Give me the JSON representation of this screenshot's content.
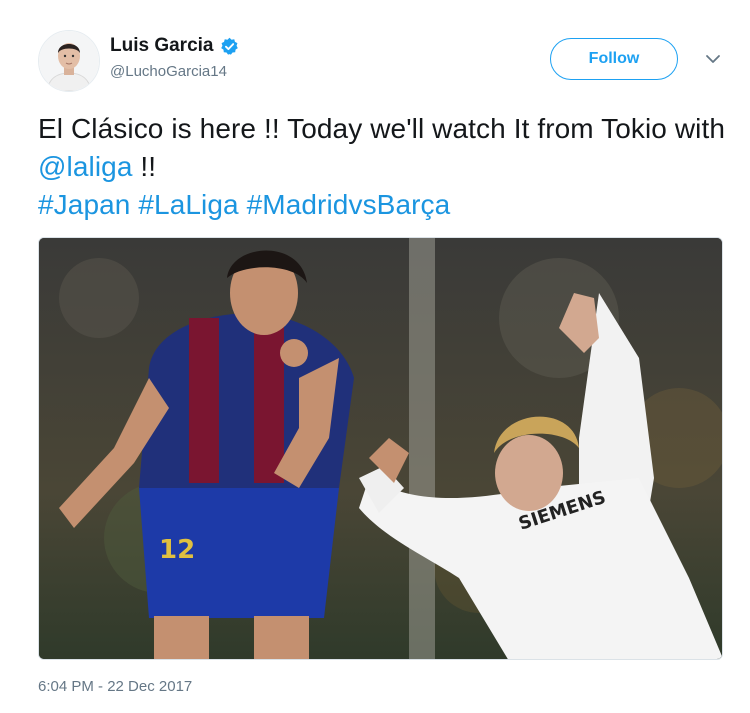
{
  "user": {
    "display_name": "Luis Garcia",
    "handle": "@LuchoGarcia14",
    "verified": true
  },
  "actions": {
    "follow_label": "Follow"
  },
  "tweet": {
    "text_part1": "El Clásico is here !! Today we'll watch It from Tokio with ",
    "mention": "@laliga",
    "text_part2": " !!",
    "hashtags": [
      "#Japan",
      "#LaLiga",
      "#MadridvsBarça"
    ]
  },
  "media": {
    "jersey_number": "12",
    "sponsor_text": "SIEMENS"
  },
  "timestamp": "6:04 PM - 22 Dec 2017",
  "colors": {
    "link": "#1b95e0",
    "follow": "#1da1f2",
    "secondary_text": "#657786"
  }
}
